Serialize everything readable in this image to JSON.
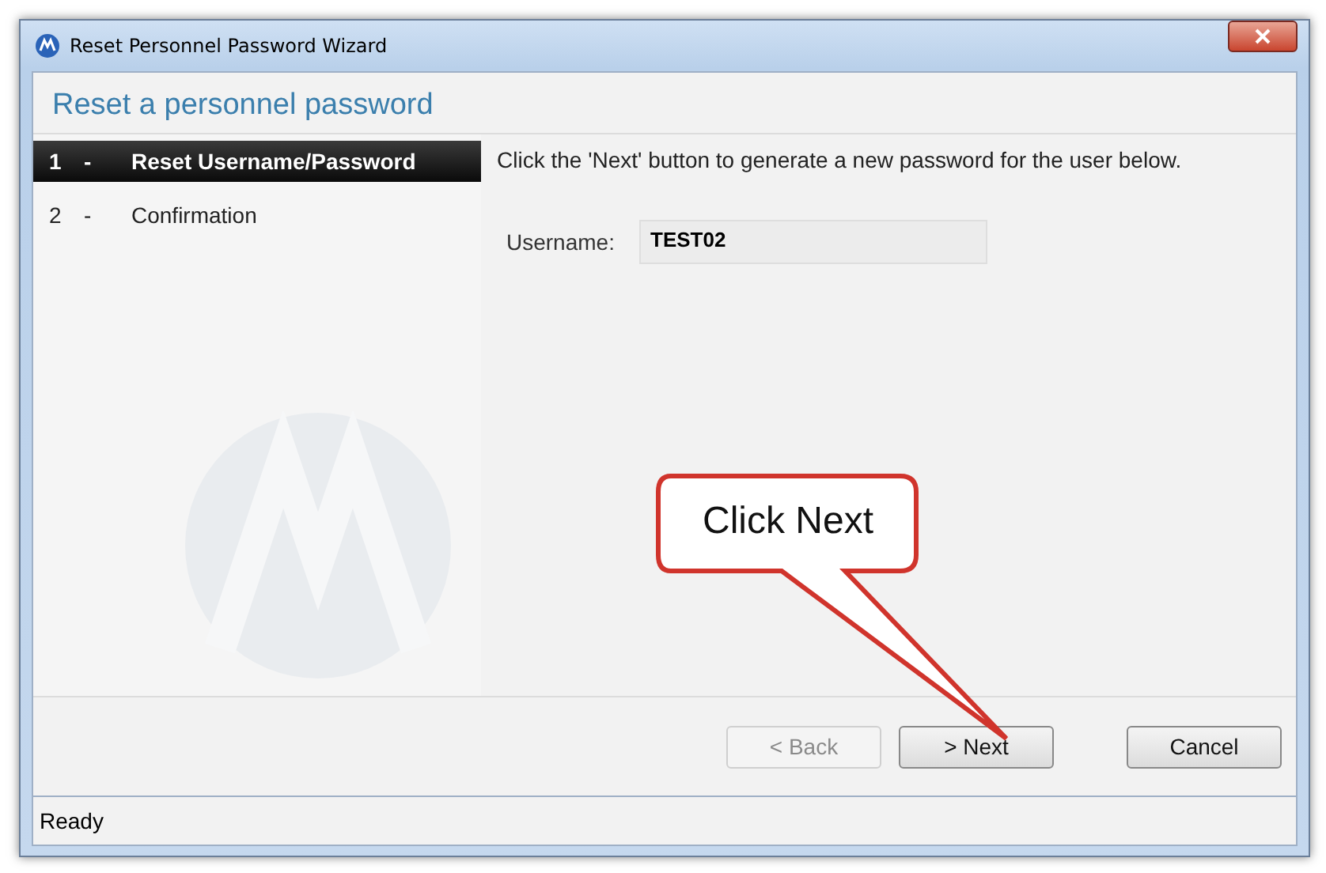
{
  "window": {
    "title": "Reset Personnel Password Wizard"
  },
  "header": {
    "title": "Reset a personnel password"
  },
  "steps": [
    {
      "number": "1",
      "separator": "-",
      "label": "Reset Username/Password",
      "selected": true
    },
    {
      "number": "2",
      "separator": "-",
      "label": "Confirmation",
      "selected": false
    }
  ],
  "instruction": "Click the 'Next' button to generate a new password for the user below.",
  "username": {
    "label": "Username:",
    "value": "TEST02"
  },
  "callout": {
    "text": "Click Next"
  },
  "buttons": [
    {
      "label": "< Back",
      "disabled": true
    },
    {
      "label": "> Next",
      "disabled": false
    },
    {
      "label": "Cancel",
      "disabled": false
    }
  ],
  "status_bar": "Ready"
}
